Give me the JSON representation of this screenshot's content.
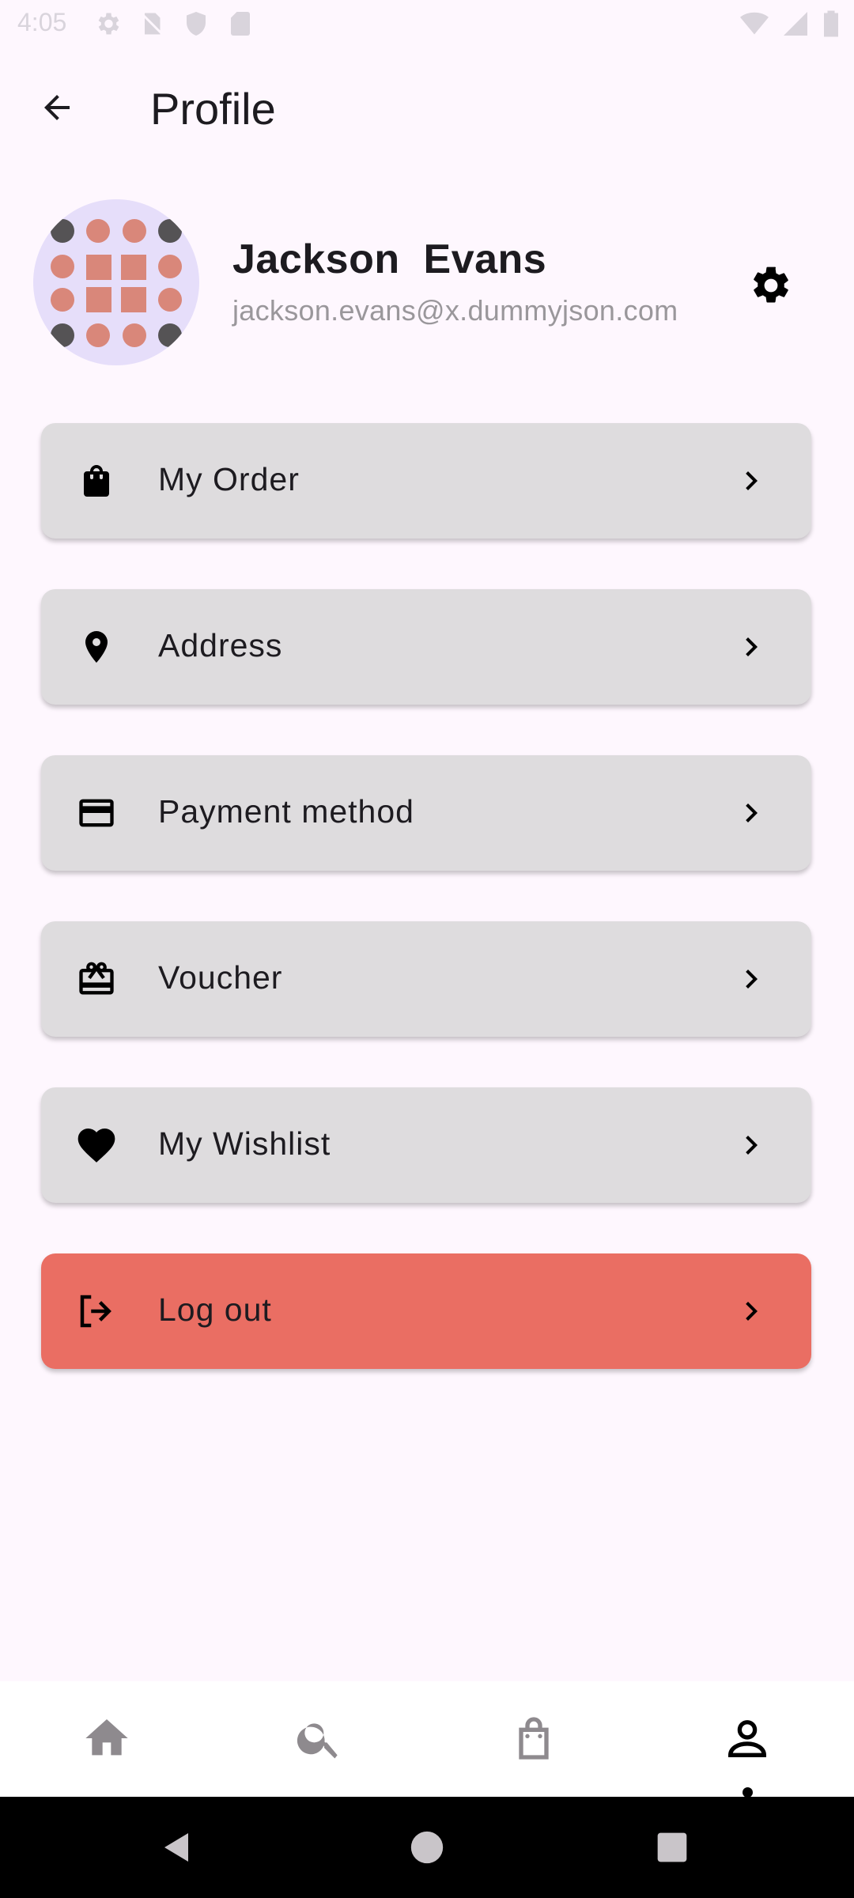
{
  "status_bar": {
    "time": "4:05",
    "icons_left": [
      "settings-icon",
      "no-sim-icon",
      "shield-icon",
      "sd-card-icon"
    ],
    "icons_right": [
      "wifi-icon",
      "signal-icon",
      "battery-icon"
    ]
  },
  "app_bar": {
    "back_icon": "arrow-back-icon",
    "title": "Profile"
  },
  "profile": {
    "name": "Jackson  Evans",
    "email": "jackson.evans@x.dummyjson.com",
    "avatar_icon": "avatar-pattern",
    "settings_icon": "gear-icon"
  },
  "menu": {
    "items": [
      {
        "label": "My Order",
        "icon": "shopping-bag-icon"
      },
      {
        "label": "Address",
        "icon": "location-pin-icon"
      },
      {
        "label": "Payment method",
        "icon": "credit-card-icon"
      },
      {
        "label": "Voucher",
        "icon": "gift-card-icon"
      },
      {
        "label": "My Wishlist",
        "icon": "heart-icon"
      },
      {
        "label": "Log out",
        "icon": "logout-icon"
      }
    ]
  },
  "bottom_nav": {
    "items": [
      "home-icon",
      "search-icon",
      "bag-icon",
      "person-icon"
    ],
    "active": "person-icon"
  },
  "colors": {
    "background": "#fef7fe",
    "menu_item": "#dedcde",
    "logout": "#ea6e63",
    "avatar_bg": "#e6defa",
    "avatar_accent": "#d9877a",
    "email_text": "#9a979b"
  }
}
